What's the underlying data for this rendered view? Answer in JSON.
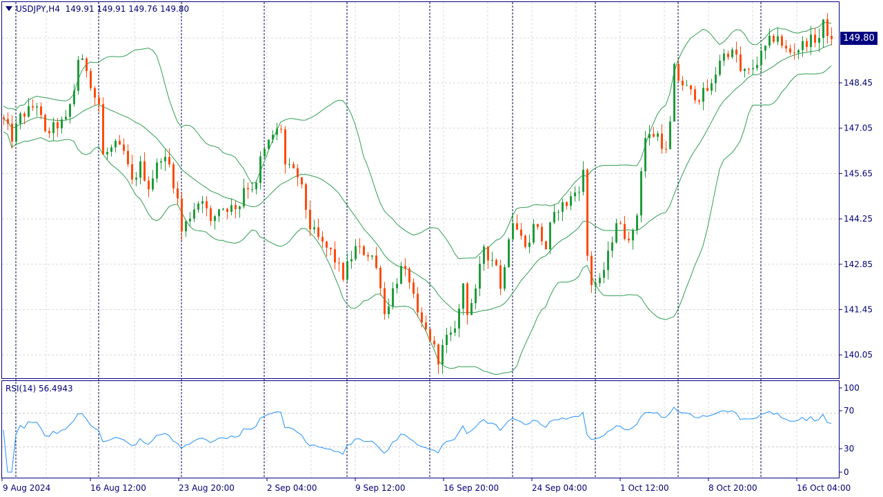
{
  "header": {
    "symbol": "USDJPY,H4",
    "open": "149.91",
    "high": "149.91",
    "low": "149.76",
    "close": "149.80"
  },
  "last_price_label": "149.80",
  "rsi": {
    "label": "RSI(14)",
    "value": "56.4943",
    "levels": [
      "100",
      "70",
      "30",
      "0"
    ]
  },
  "colors": {
    "up": "#1f9b3a",
    "down": "#ff4a0a",
    "bands": "#2f9d52",
    "rsi": "#1e90ff",
    "frame": "#000080"
  },
  "chart_data": {
    "type": "candlestick",
    "title": "USDJPY,H4",
    "indicators": [
      "Bollinger Bands(20,2)",
      "RSI(14)"
    ],
    "price_ticks": [
      "148.45",
      "147.05",
      "145.65",
      "144.25",
      "142.85",
      "141.45",
      "140.05"
    ],
    "time_labels": [
      "9 Aug 2024",
      "16 Aug 12:00",
      "23 Aug 20:00",
      "2 Sep 04:00",
      "9 Sep 12:00",
      "16 Sep 20:00",
      "24 Sep 04:00",
      "1 Oct 12:00",
      "8 Oct 20:00",
      "16 Oct 04:00"
    ],
    "bar_count": 201,
    "close_path": [
      [
        0,
        147.28
      ],
      [
        2,
        146.75
      ],
      [
        4,
        147.4
      ],
      [
        7,
        147.7
      ],
      [
        8,
        147.8
      ],
      [
        10,
        146.85
      ],
      [
        12,
        147.07
      ],
      [
        15,
        147.28
      ],
      [
        17,
        148.24
      ],
      [
        18,
        149.2
      ],
      [
        20,
        148.9
      ],
      [
        22,
        148.02
      ],
      [
        23,
        147.8
      ],
      [
        24,
        146.2
      ],
      [
        27,
        146.5
      ],
      [
        29,
        146.3
      ],
      [
        31,
        145.36
      ],
      [
        33,
        145.9
      ],
      [
        35,
        145.25
      ],
      [
        38,
        146.2
      ],
      [
        40,
        145.9
      ],
      [
        42,
        144.83
      ],
      [
        43,
        143.87
      ],
      [
        46,
        144.6
      ],
      [
        48,
        144.93
      ],
      [
        50,
        144.08
      ],
      [
        52,
        144.6
      ],
      [
        55,
        144.6
      ],
      [
        57,
        144.7
      ],
      [
        58,
        145.25
      ],
      [
        61,
        145.25
      ],
      [
        62,
        146.1
      ],
      [
        65,
        146.85
      ],
      [
        67,
        147.07
      ],
      [
        68,
        145.9
      ],
      [
        71,
        145.57
      ],
      [
        72,
        145.15
      ],
      [
        74,
        144.0
      ],
      [
        77,
        143.45
      ],
      [
        79,
        143.23
      ],
      [
        82,
        142.48
      ],
      [
        83,
        142.8
      ],
      [
        85,
        143.34
      ],
      [
        87,
        143.23
      ],
      [
        89,
        143.12
      ],
      [
        91,
        142.27
      ],
      [
        92,
        141.31
      ],
      [
        94,
        142.06
      ],
      [
        96,
        142.7
      ],
      [
        98,
        142.38
      ],
      [
        100,
        141.2
      ],
      [
        102,
        140.78
      ],
      [
        103,
        140.57
      ],
      [
        105,
        139.93
      ],
      [
        107,
        140.57
      ],
      [
        108,
        140.57
      ],
      [
        110,
        141.42
      ],
      [
        111,
        142.27
      ],
      [
        112,
        141.42
      ],
      [
        114,
        141.95
      ],
      [
        116,
        143.44
      ],
      [
        117,
        143.12
      ],
      [
        119,
        142.9
      ],
      [
        120,
        142.06
      ],
      [
        122,
        143.76
      ],
      [
        123,
        144.19
      ],
      [
        125,
        143.66
      ],
      [
        127,
        143.45
      ],
      [
        128,
        144.19
      ],
      [
        131,
        143.34
      ],
      [
        132,
        144.0
      ],
      [
        134,
        144.62
      ],
      [
        136,
        144.72
      ],
      [
        139,
        145.25
      ],
      [
        140,
        145.68
      ],
      [
        141,
        143.12
      ],
      [
        142,
        142.27
      ],
      [
        144,
        142.27
      ],
      [
        146,
        143.12
      ],
      [
        148,
        144.19
      ],
      [
        150,
        143.76
      ],
      [
        152,
        143.76
      ],
      [
        153,
        144.4
      ],
      [
        153.5,
        145.36
      ],
      [
        155,
        146.75
      ],
      [
        157,
        146.85
      ],
      [
        158,
        146.85
      ],
      [
        160,
        146.3
      ],
      [
        161,
        147.17
      ],
      [
        162,
        148.88
      ],
      [
        163,
        148.56
      ],
      [
        166,
        148.13
      ],
      [
        168,
        148.02
      ],
      [
        171,
        148.34
      ],
      [
        173,
        149.2
      ],
      [
        175,
        149.41
      ],
      [
        177,
        149.3
      ],
      [
        178,
        148.77
      ],
      [
        180,
        148.77
      ],
      [
        182,
        149.1
      ],
      [
        183,
        149.3
      ],
      [
        185,
        149.73
      ],
      [
        187,
        149.94
      ],
      [
        188,
        149.52
      ],
      [
        190,
        149.41
      ],
      [
        192,
        149.52
      ],
      [
        194,
        149.73
      ],
      [
        197,
        149.84
      ],
      [
        198,
        150.26
      ],
      [
        200,
        149.8
      ]
    ]
  }
}
